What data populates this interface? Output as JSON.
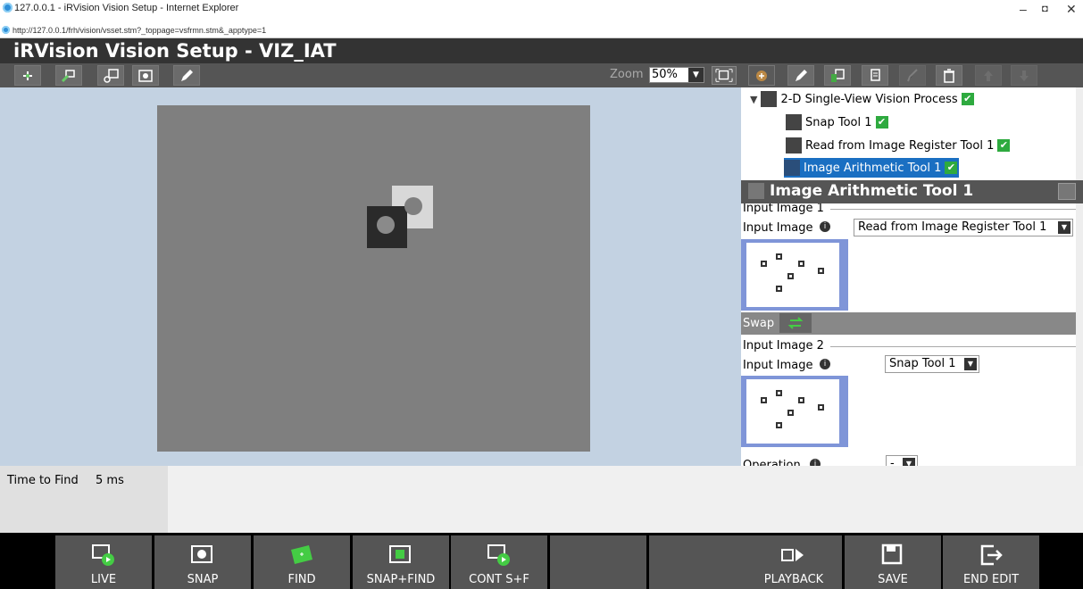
{
  "browser": {
    "title": "127.0.0.1 - iRVision Vision Setup - Internet Explorer",
    "url": "http://127.0.0.1/frh/vision/vsset.stm?_toppage=vsfrmn.stm&_apptype=1",
    "minimize": "–",
    "maximize": "◘",
    "close": "✕"
  },
  "app": {
    "title": "iRVision Vision Setup - VIZ_IAT"
  },
  "toolbar": {
    "zoom_label": "Zoom",
    "zoom_value": "50%",
    "tools": [
      "crosshair-icon",
      "camera-teach-icon",
      "save-image-icon",
      "snap-image-icon",
      "pencil-icon"
    ]
  },
  "tree": {
    "items": [
      {
        "label": "2-D Single-View Vision Process",
        "checked": true
      },
      {
        "label": "Snap Tool 1",
        "checked": true
      },
      {
        "label": "Read from Image Register Tool 1",
        "checked": true
      },
      {
        "label": "Image Arithmetic Tool 1",
        "checked": true
      }
    ],
    "checkmark": "✔"
  },
  "properties": {
    "title": "Image Arithmetic Tool 1",
    "group1_title": "Input Image 1",
    "input1_label": "Input Image",
    "input1_value": "Read from Image Register Tool 1",
    "swap_label": "Swap",
    "group2_title": "Input Image 2",
    "input2_label": "Input Image",
    "input2_value": "Snap Tool 1",
    "operation_label": "Operation",
    "operation_value": "-",
    "info_icon": "i",
    "arrow": "▼"
  },
  "status": {
    "time_label": "Time to Find",
    "time_value": "5 ms"
  },
  "bottom_buttons": [
    "LIVE",
    "SNAP",
    "FIND",
    "SNAP+FIND",
    "CONT S+F",
    "",
    "",
    "PLAYBACK",
    "SAVE",
    "END EDIT"
  ],
  "colors": {
    "accent": "#1a6fc2",
    "check": "#2eaa3f",
    "title_bar": "#333333"
  }
}
